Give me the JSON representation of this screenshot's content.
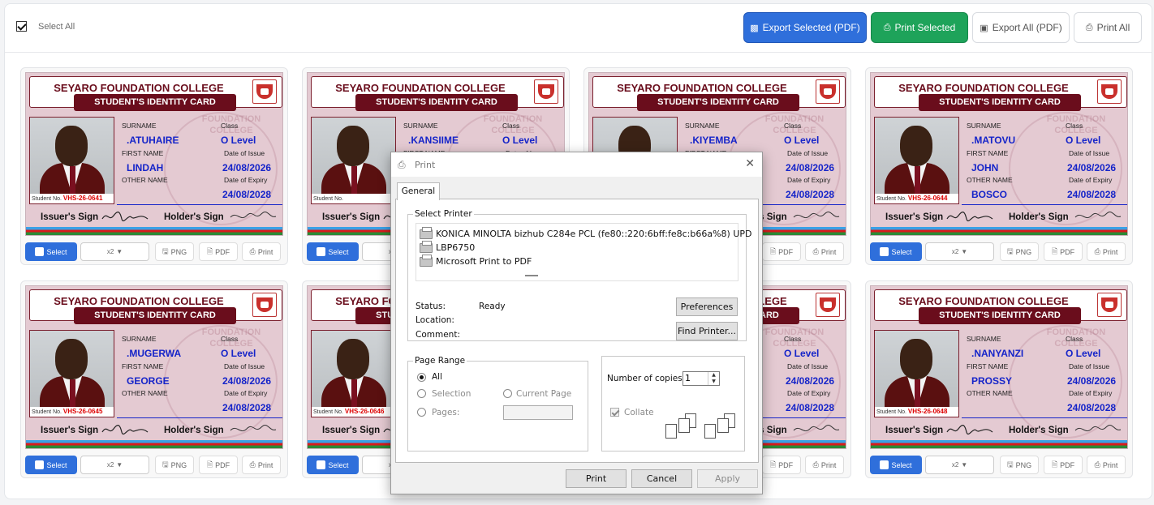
{
  "toolbar": {
    "select_all_label": "Select All",
    "export_selected_label": "Export Selected (PDF)",
    "print_selected_label": "Print Selected",
    "export_all_label": "Export All (PDF)",
    "print_all_label": "Print All"
  },
  "card_common": {
    "school": "SEYARO FOUNDATION COLLEGE",
    "card_type": "STUDENT'S IDENTITY CARD",
    "surname_label": "SURNAME",
    "first_name_label": "FIRST NAME",
    "other_name_label": "OTHER NAME",
    "class_label": "Class",
    "issue_label": "Date of Issue",
    "expiry_label": "Date of Expiry",
    "student_no_label": "Student No.",
    "issuer_sign": "Issuer's Sign",
    "holder_sign": "Holder's Sign",
    "select_btn": "Select",
    "scale_option": "x2",
    "png_btn": "PNG",
    "pdf_btn": "PDF",
    "print_btn": "Print",
    "watermark": "FOUNDATION COLLEGE"
  },
  "cards": [
    {
      "surname": ".ATUHAIRE",
      "first_name": "LINDAH",
      "other_name": "",
      "class": "O Level",
      "issue": "24/08/2026",
      "expiry": "24/08/2028",
      "student_no": "VHS-26-0641"
    },
    {
      "surname": ".KANSIIME",
      "first_name": "",
      "other_name": "",
      "class": "O Level",
      "issue": "",
      "expiry": "",
      "student_no": ""
    },
    {
      "surname": ".KIYEMBA",
      "first_name": "",
      "other_name": "",
      "class": "O Level",
      "issue": "24/08/2026",
      "expiry": "24/08/2028",
      "student_no": ""
    },
    {
      "surname": ".MATOVU",
      "first_name": "JOHN",
      "other_name": "BOSCO",
      "class": "O Level",
      "issue": "24/08/2026",
      "expiry": "24/08/2028",
      "student_no": "VHS-26-0644"
    },
    {
      "surname": ".MUGERWA",
      "first_name": "GEORGE",
      "other_name": "",
      "class": "O Level",
      "issue": "24/08/2026",
      "expiry": "24/08/2028",
      "student_no": "VHS-26-0645"
    },
    {
      "surname": "",
      "first_name": "",
      "other_name": "",
      "class": "",
      "issue": "",
      "expiry": "",
      "student_no": "VHS-26-0646"
    },
    {
      "surname": "",
      "first_name": "",
      "other_name": "",
      "class": "O Level",
      "issue": "24/08/2026",
      "expiry": "24/08/2028",
      "student_no": ""
    },
    {
      "surname": ".NANYANZI",
      "first_name": "PROSSY",
      "other_name": "",
      "class": "O Level",
      "issue": "24/08/2026",
      "expiry": "24/08/2028",
      "student_no": "VHS-26-0648"
    }
  ],
  "print_dialog": {
    "title": "Print",
    "tab_general": "General",
    "select_printer_legend": "Select Printer",
    "printers": [
      "KONICA MINOLTA bizhub C284e PCL (fe80::220:6bff:fe8c:b66a%8) UPD",
      "LBP6750",
      "Microsoft Print to PDF"
    ],
    "status_label": "Status:",
    "status_value": "Ready",
    "location_label": "Location:",
    "comment_label": "Comment:",
    "preferences_btn": "Preferences",
    "find_printer_btn": "Find Printer...",
    "page_range_legend": "Page Range",
    "all_label": "All",
    "selection_label": "Selection",
    "current_page_label": "Current Page",
    "pages_label": "Pages:",
    "copies_label": "Number of copies:",
    "copies_value": "1",
    "collate_label": "Collate",
    "print_btn": "Print",
    "cancel_btn": "Cancel",
    "apply_btn": "Apply"
  }
}
